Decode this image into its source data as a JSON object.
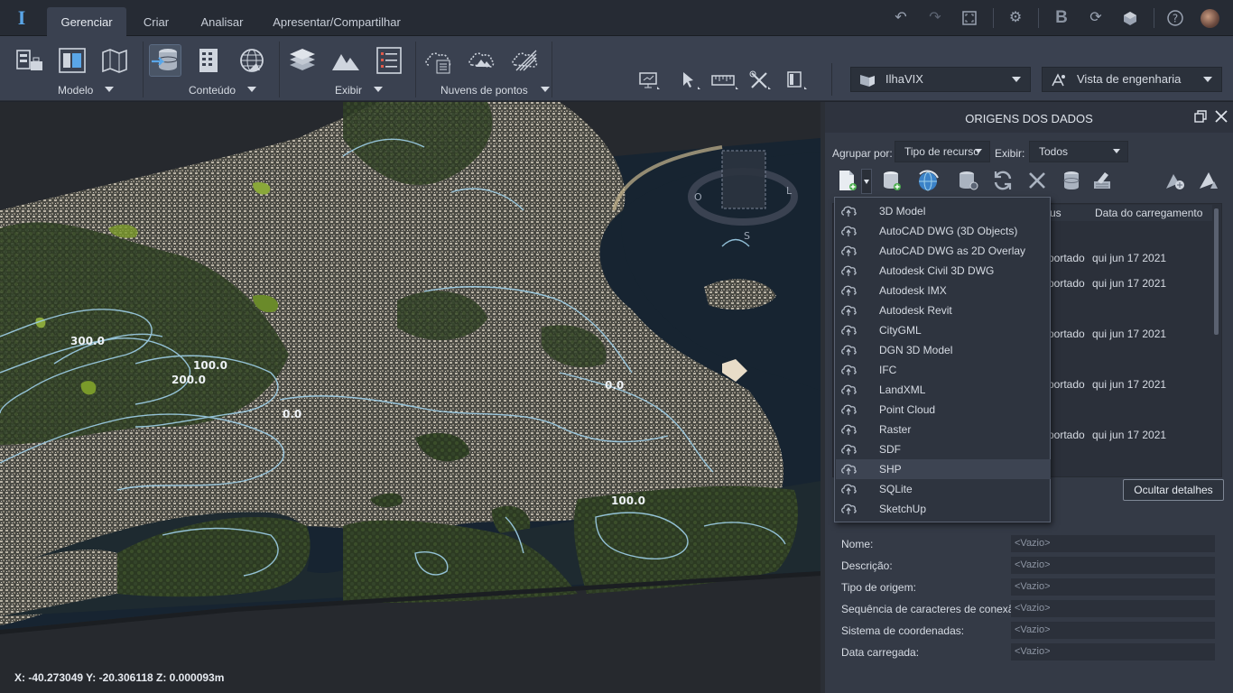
{
  "titlebar": {
    "tabs": [
      {
        "label": "Gerenciar",
        "active": true
      },
      {
        "label": "Criar"
      },
      {
        "label": "Analisar"
      },
      {
        "label": "Apresentar/Compartilhar"
      }
    ],
    "icons": [
      "undo-icon",
      "redo-icon",
      "fit-screen-icon",
      "settings-icon",
      "bim-icon",
      "sync-icon",
      "cloud-model-icon",
      "help-icon",
      "avatar"
    ]
  },
  "ribbon": {
    "groups": [
      {
        "label": "Modelo"
      },
      {
        "label": "Conteúdo"
      },
      {
        "label": "Exibir"
      },
      {
        "label": "Nuvens de pontos"
      }
    ],
    "model_combo": "IlhaVIX",
    "view_combo": "Vista de engenharia"
  },
  "viewport": {
    "contour_labels": [
      "300.0",
      "100.0",
      "200.0",
      "0.0",
      "0.0",
      "100.0"
    ],
    "compass": {
      "west": "O",
      "south": "S",
      "east": "L"
    },
    "coordinates": "X: -40.273049 Y: -20.306118 Z: 0.000093m"
  },
  "panel": {
    "title": "ORIGENS DOS DADOS",
    "group_by_label": "Agrupar por:",
    "group_by_value": "Tipo de recurso",
    "show_label": "Exibir:",
    "show_value": "Todos",
    "columns": [
      "atus",
      "Data do carregamento"
    ],
    "rows": [
      {
        "status": "portado",
        "date": "qui jun 17 2021"
      },
      {
        "status": "portado",
        "date": "qui jun 17 2021"
      },
      {
        "status": "portado",
        "date": "qui jun 17 2021"
      },
      {
        "status": "portado",
        "date": "qui jun 17 2021"
      },
      {
        "status": "portado",
        "date": "qui jun 17 2021"
      }
    ],
    "hide_details": "Ocultar detalhes",
    "properties": [
      {
        "name": "Nome:",
        "value": "<Vazio>"
      },
      {
        "name": "Descrição:",
        "value": "<Vazio>"
      },
      {
        "name": "Tipo de origem:",
        "value": "<Vazio>"
      },
      {
        "name": "Sequência de caracteres de conexão:",
        "value": "<Vazio>"
      },
      {
        "name": "Sistema de coordenadas:",
        "value": "<Vazio>"
      },
      {
        "name": "Data carregada:",
        "value": "<Vazio>"
      }
    ]
  },
  "dropdown": {
    "items": [
      {
        "label": "3D Model"
      },
      {
        "label": "AutoCAD DWG (3D Objects)"
      },
      {
        "label": "AutoCAD DWG as 2D Overlay"
      },
      {
        "label": "Autodesk Civil 3D DWG"
      },
      {
        "label": "Autodesk IMX"
      },
      {
        "label": "Autodesk Revit"
      },
      {
        "label": "CityGML"
      },
      {
        "label": "DGN 3D Model"
      },
      {
        "label": "IFC"
      },
      {
        "label": "LandXML"
      },
      {
        "label": "Point Cloud"
      },
      {
        "label": "Raster"
      },
      {
        "label": "SDF"
      },
      {
        "label": "SHP",
        "hover": true
      },
      {
        "label": "SQLite"
      },
      {
        "label": "SketchUp"
      }
    ]
  }
}
